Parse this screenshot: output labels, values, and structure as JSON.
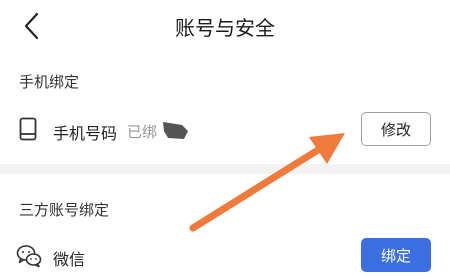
{
  "header": {
    "back_icon": "chevron-left-icon",
    "title": "账号与安全"
  },
  "phone_section": {
    "title": "手机绑定",
    "row": {
      "icon": "phone-icon",
      "label": "手机号码",
      "status": "已绑",
      "button": "修改"
    }
  },
  "third_party_section": {
    "title": "三方账号绑定",
    "row": {
      "icon": "wechat-icon",
      "label": "微信",
      "button": "绑定"
    }
  },
  "annotation": {
    "type": "arrow",
    "color": "#f07a3c",
    "points_to": "修改"
  },
  "colors": {
    "primary_button": "#3b6fe0",
    "divider": "#f2f2f2",
    "status_text": "#9a9a9a"
  }
}
